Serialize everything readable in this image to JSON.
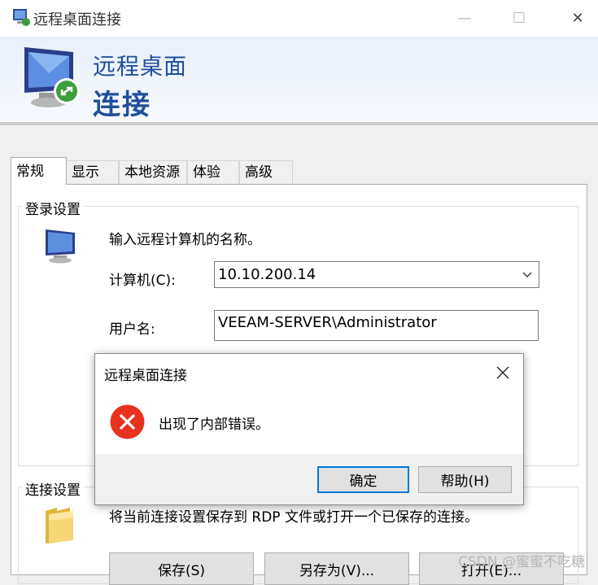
{
  "window": {
    "title": "远程桌面连接",
    "minimize": "—",
    "maximize": "☐",
    "close": "✕"
  },
  "banner": {
    "title": "远程桌面",
    "subtitle": "连接"
  },
  "tabs": [
    {
      "label": "常规",
      "active": true
    },
    {
      "label": "显示",
      "active": false
    },
    {
      "label": "本地资源",
      "active": false
    },
    {
      "label": "体验",
      "active": false
    },
    {
      "label": "高级",
      "active": false
    }
  ],
  "logon": {
    "group_label": "登录设置",
    "instruction": "输入远程计算机的名称。",
    "computer_label": "计算机(C):",
    "computer_value": "10.10.200.14",
    "username_label": "用户名:",
    "username_value": "VEEAM-SERVER\\Administrator"
  },
  "connection": {
    "group_label": "连接设置",
    "description": "将当前连接设置保存到 RDP 文件或打开一个已保存的连接。",
    "save_label": "保存(S)",
    "save_as_label": "另存为(V)...",
    "open_label": "打开(E)..."
  },
  "dialog": {
    "title": "远程桌面连接",
    "message": "出现了内部错误。",
    "ok_label": "确定",
    "help_label": "帮助(H)"
  },
  "watermark": "CSDN @蜜蜜不吃糖",
  "colors": {
    "accent": "#1f4f9c",
    "error": "#e8321e",
    "default_button_border": "#0078d7"
  }
}
